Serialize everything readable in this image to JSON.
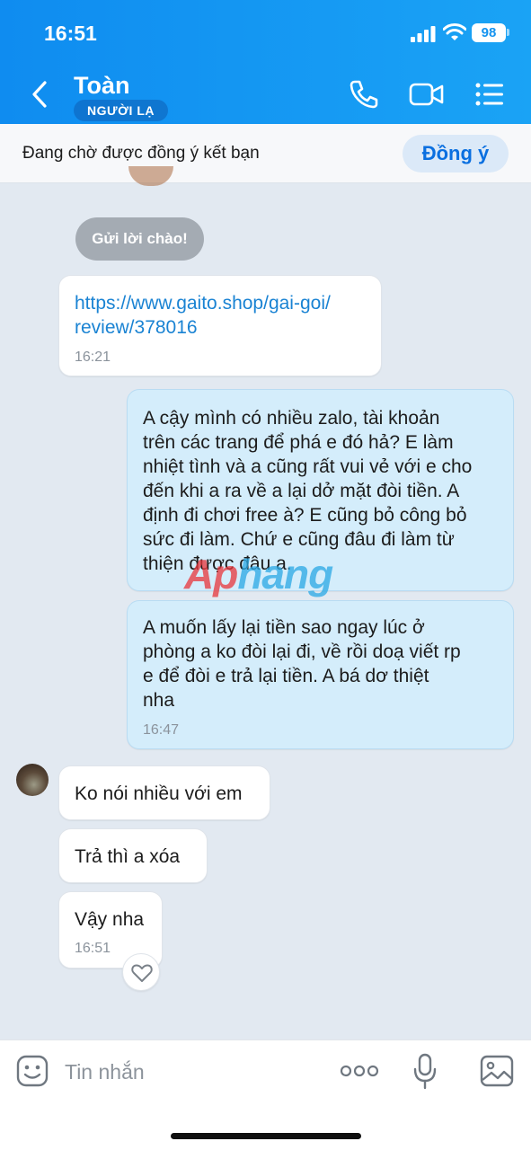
{
  "status_bar": {
    "time": "16:51",
    "battery": "98"
  },
  "header": {
    "contact_name": "Toàn",
    "stranger_badge": "NGƯỜI LẠ"
  },
  "friend_request": {
    "text": "Đang chờ được đồng ý kết bạn",
    "accept_label": "Đồng ý"
  },
  "greeting_chip": "Gửi lời chào!",
  "watermark": {
    "part1": "Ap",
    "part2": "hang"
  },
  "messages": [
    {
      "direction": "incoming",
      "text_line1": "https://www.gaito.shop/gai-goi/",
      "text_line2": "review/378016",
      "time": "16:21"
    },
    {
      "direction": "outgoing",
      "lines": [
        "A cậy mình có nhiều zalo, tài khoản",
        "trên các trang để phá e đó hả? E làm",
        "nhiệt tình và a cũng rất vui vẻ với e cho",
        "đến khi a ra về a lại dở mặt đòi tiền. A",
        "định đi chơi free à? E cũng bỏ công bỏ",
        "sức đi làm. Chứ e cũng đâu đi làm từ",
        "thiện được đâu a."
      ]
    },
    {
      "direction": "outgoing",
      "lines": [
        "A muốn lấy lại tiền sao ngay lúc ở",
        "phòng a ko đòi lại đi, về rồi doạ viết rp",
        "e để đòi e trả lại tiền. A bá dơ thiệt",
        "nha"
      ],
      "time": "16:47"
    },
    {
      "direction": "incoming",
      "text": "Ko nói nhiều với em"
    },
    {
      "direction": "incoming",
      "text": "Trả thì a xóa"
    },
    {
      "direction": "incoming",
      "text": "Vậy nha",
      "time": "16:51"
    }
  ],
  "input": {
    "placeholder": "Tin nhắn"
  },
  "colors": {
    "header_blue": "#1493ef",
    "link_blue": "#1a83d3",
    "outgoing_bubble": "#d4edfb",
    "chat_bg": "#e2e9f1"
  }
}
